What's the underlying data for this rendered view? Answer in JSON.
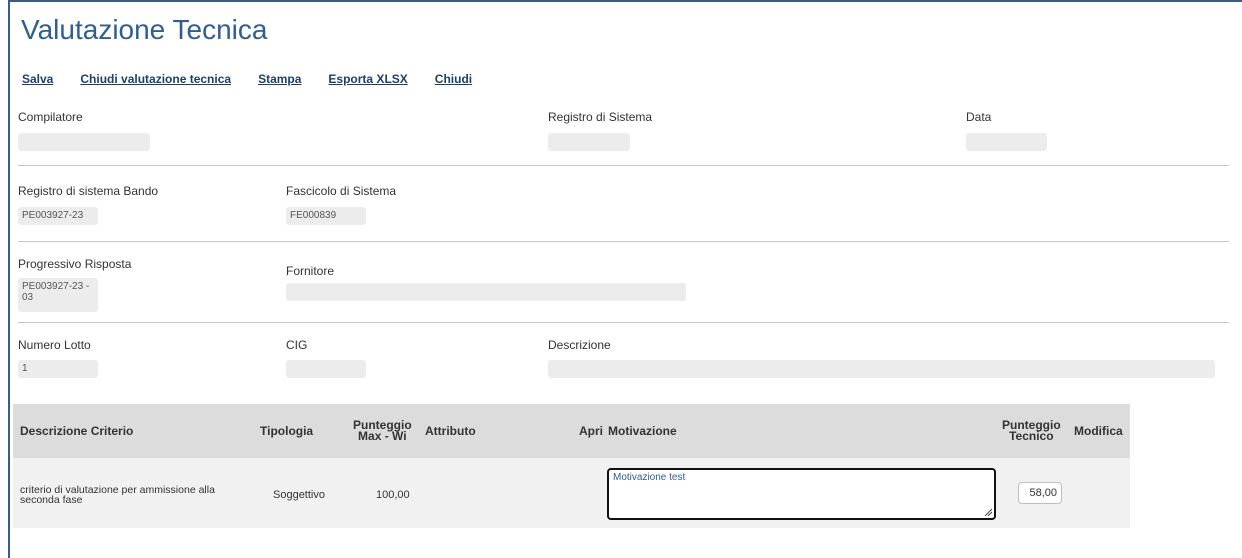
{
  "page": {
    "title": "Valutazione Tecnica"
  },
  "toolbar": {
    "save": "Salva",
    "close_evaluation": "Chiudi valutazione tecnica",
    "print": "Stampa",
    "export_xlsx": "Esporta XLSX",
    "close": "Chiudi"
  },
  "section1": {
    "compiler_label": "Compilatore",
    "compiler_value": "",
    "system_register_label": "Registro di Sistema",
    "system_register_value": "",
    "date_label": "Data",
    "date_value": ""
  },
  "section2": {
    "tender_register_label": "Registro di sistema Bando",
    "tender_register_value": "PE003927-23",
    "system_file_label": "Fascicolo di Sistema",
    "system_file_value": "FE000839"
  },
  "section3": {
    "response_progressive_label": "Progressivo Risposta",
    "response_progressive_line1": "PE003927-23 -",
    "response_progressive_line2": "03",
    "supplier_label": "Fornitore",
    "supplier_value": ""
  },
  "section4": {
    "lot_number_label": "Numero Lotto",
    "lot_number_value": "1",
    "cig_label": "CIG",
    "cig_value": "",
    "description_label": "Descrizione",
    "description_value": ""
  },
  "table": {
    "headers": {
      "criterion": "Descrizione Criterio",
      "type": "Tipologia",
      "max_score_line1": "Punteggio",
      "max_score_line2": "Max - Wi",
      "attribute": "Attributo",
      "open": "Apri",
      "motivation": "Motivazione",
      "tech_score_line1": "Punteggio",
      "tech_score_line2": "Tecnico",
      "modify": "Modifica"
    },
    "rows": [
      {
        "criterion_line1": "criterio di valutazione per ammissione alla",
        "criterion_line2": "seconda fase",
        "type": "Soggettivo",
        "max_score": "100,00",
        "attribute": "",
        "motivation": "Motivazione test",
        "tech_score": "58,00"
      }
    ]
  },
  "colors": {
    "title": "#2f5f8f",
    "link": "#1f3f6b",
    "frame": "#3a5b82",
    "field_bg": "#ececec",
    "table_header_bg": "#dcdcdc"
  }
}
